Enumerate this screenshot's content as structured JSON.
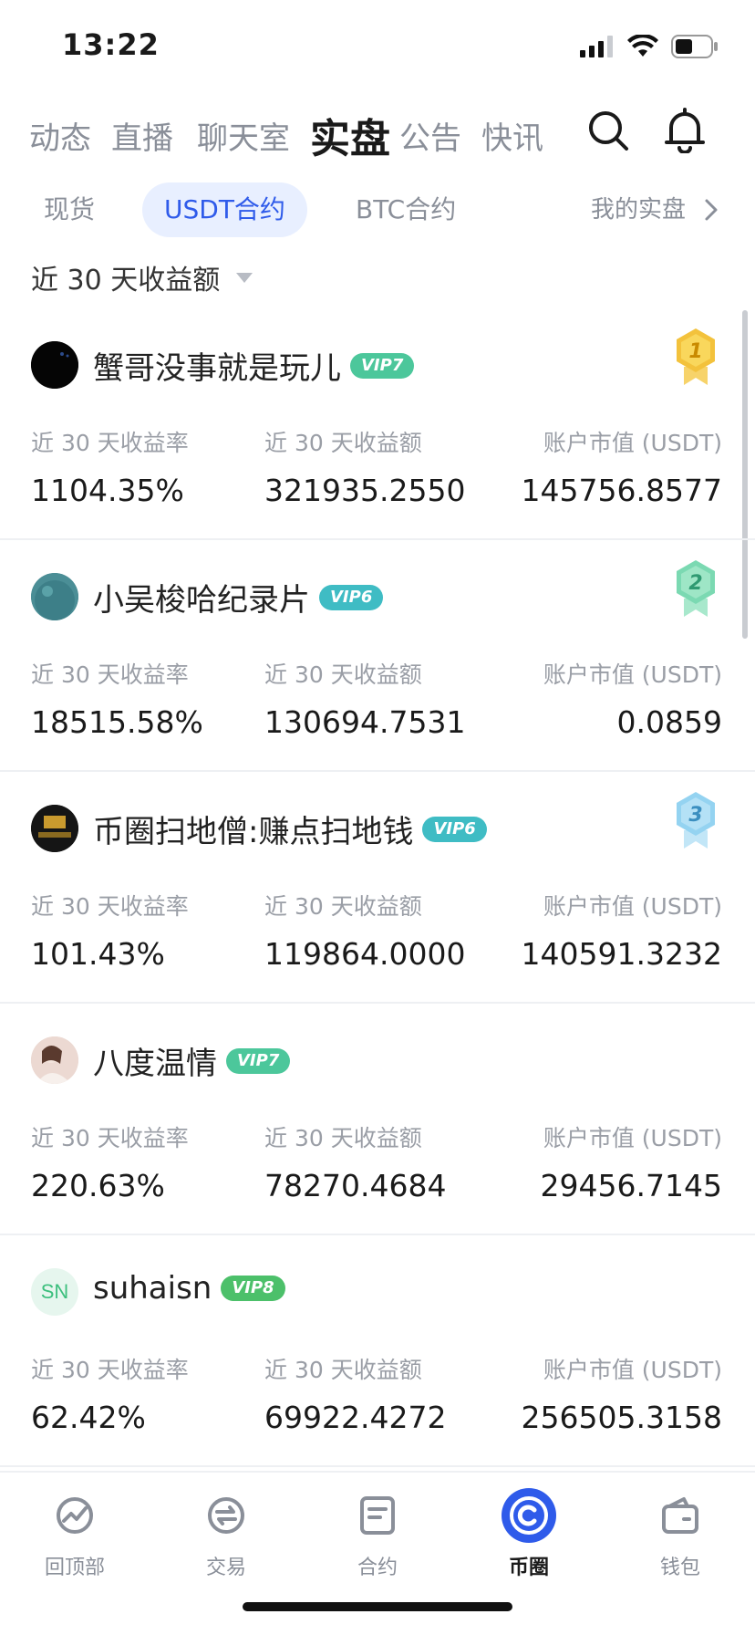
{
  "status": {
    "time": "13:22"
  },
  "topnav": {
    "tabs": [
      "动态",
      "直播",
      "聊天室",
      "实盘",
      "公告",
      "快讯"
    ],
    "active": "实盘"
  },
  "subtabs": {
    "items": [
      "现货",
      "USDT合约",
      "BTC合约"
    ],
    "active": "USDT合约",
    "mine": "我的实盘"
  },
  "filter": {
    "label": "近 30 天收益额"
  },
  "columns": {
    "rate": "近 30 天收益率",
    "profit": "近 30 天收益额",
    "value": "账户市值 (USDT)"
  },
  "traders": [
    {
      "name": "蟹哥没事就是玩儿",
      "vip": "VIP7",
      "rate": "1104.35%",
      "profit": "321935.2550",
      "value": "145756.8577",
      "medal": "1",
      "medal_color": "#f3c23c"
    },
    {
      "name": "小吴梭哈纪录片",
      "vip": "VIP6",
      "rate": "18515.58%",
      "profit": "130694.7531",
      "value": "0.0859",
      "medal": "2",
      "medal_color": "#6fd3a8"
    },
    {
      "name": "币圈扫地僧:赚点扫地钱",
      "vip": "VIP6",
      "rate": "101.43%",
      "profit": "119864.0000",
      "value": "140591.3232",
      "medal": "3",
      "medal_color": "#8ccff0"
    },
    {
      "name": "八度温情",
      "vip": "VIP7",
      "rate": "220.63%",
      "profit": "78270.4684",
      "value": "29456.7145"
    },
    {
      "name": "suhaisn",
      "vip": "VIP8",
      "rate": "62.42%",
      "profit": "69922.4272",
      "value": "256505.3158",
      "avatar_text": "SN"
    }
  ],
  "bottomnav": [
    {
      "label": "回顶部",
      "icon": "chart-icon"
    },
    {
      "label": "交易",
      "icon": "exchange-icon"
    },
    {
      "label": "合约",
      "icon": "contract-icon"
    },
    {
      "label": "币圈",
      "icon": "coin-circle-icon",
      "active": true
    },
    {
      "label": "钱包",
      "icon": "wallet-icon"
    }
  ],
  "colors": {
    "accent": "#2f5bea",
    "vip7": "#4cc79b",
    "vip6": "#3fbcc4",
    "vip8": "#4cc06a"
  }
}
